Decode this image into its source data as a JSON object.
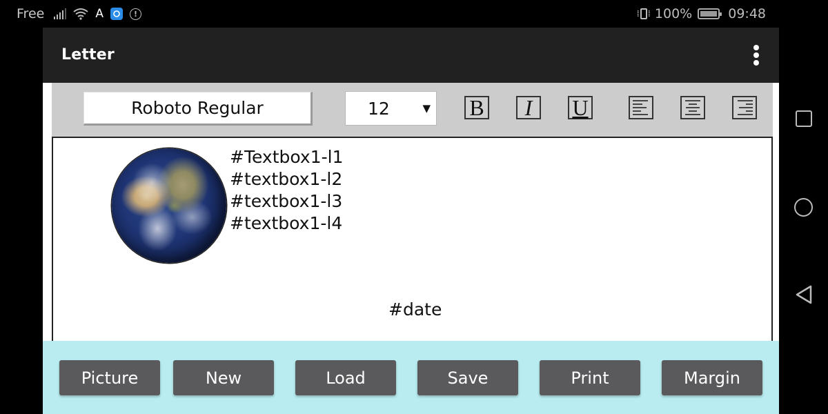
{
  "status_bar": {
    "carrier": "Free",
    "icons_left": [
      "signal-icon",
      "wifi-icon",
      "av-icon",
      "app-notification-icon",
      "alert-icon"
    ],
    "av_label": "A",
    "alert_label": "!",
    "battery_percent": "100%",
    "time": "09:48",
    "icons_right": [
      "vibrate-icon",
      "battery-icon"
    ]
  },
  "toolbar": {
    "title": "Letter",
    "menu_icon": "overflow-menu-icon"
  },
  "format_bar": {
    "font_name": "Roboto Regular",
    "font_size": "12",
    "size_arrow": "▼",
    "bold_label": "B",
    "italic_label": "I",
    "underline_label": "U",
    "align_buttons": [
      "align-left",
      "align-center",
      "align-right"
    ]
  },
  "document": {
    "textbox_lines": [
      "#Textbox1-l1",
      "#textbox1-l2",
      "#textbox1-l3",
      "#textbox1-l4"
    ],
    "date_placeholder": "#date",
    "image": "earth-globe"
  },
  "actions": {
    "picture": "Picture",
    "new": "New",
    "load": "Load",
    "save": "Save",
    "print": "Print",
    "margin": "Margin"
  },
  "colors": {
    "toolbar_bg": "#212121",
    "format_bar_bg": "#cccccc",
    "action_bar_bg": "#b8ecf0",
    "action_button_bg": "#5a5a5c"
  }
}
